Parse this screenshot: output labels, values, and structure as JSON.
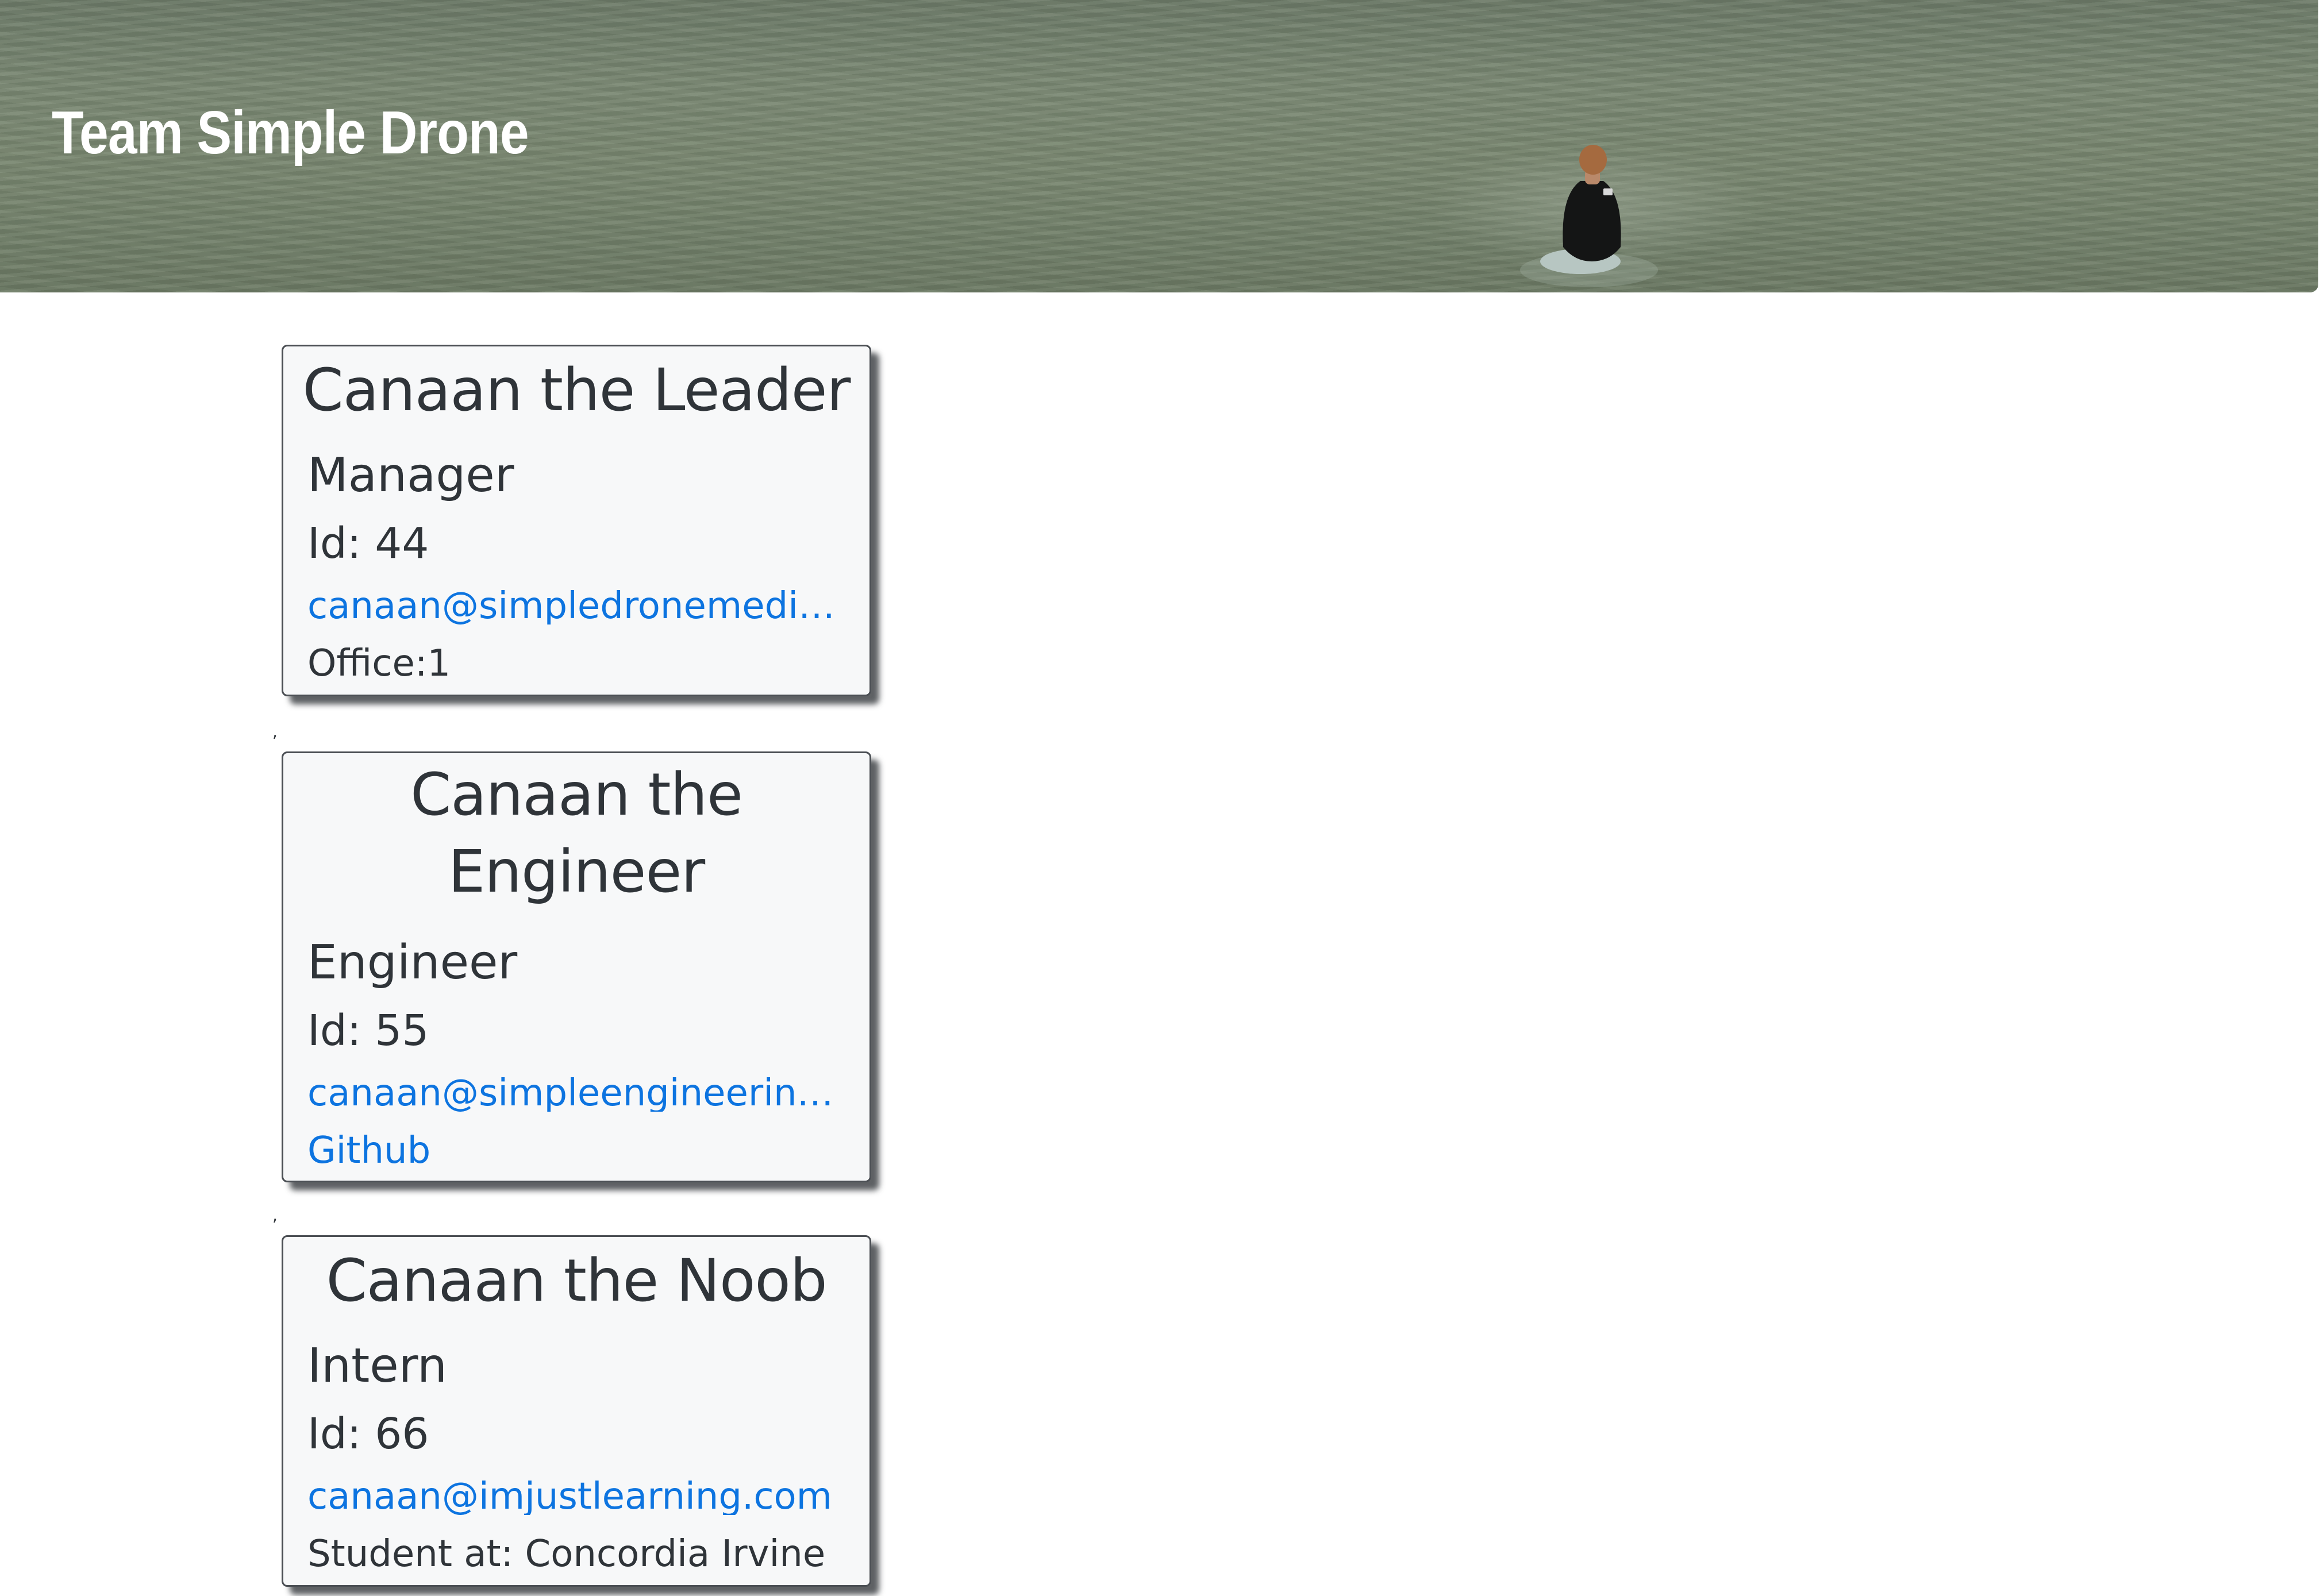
{
  "header": {
    "title": "Team Simple Drone"
  },
  "team": [
    {
      "name": "Canaan the Leader",
      "role": "Manager",
      "id": "Id: 44",
      "email": "canaan@simpledronemedia.com",
      "extra": "Office:1"
    },
    {
      "name": "Canaan the Engineer",
      "role": "Engineer",
      "id": "Id: 55",
      "email": "canaan@simpleengineering.com",
      "extra": "Github"
    },
    {
      "name": "Canaan the Noob",
      "role": "Intern",
      "id": "Id: 66",
      "email": "canaan@imjustlearning.com",
      "extra": "Student at: Concordia Irvine"
    }
  ],
  "separator": ","
}
